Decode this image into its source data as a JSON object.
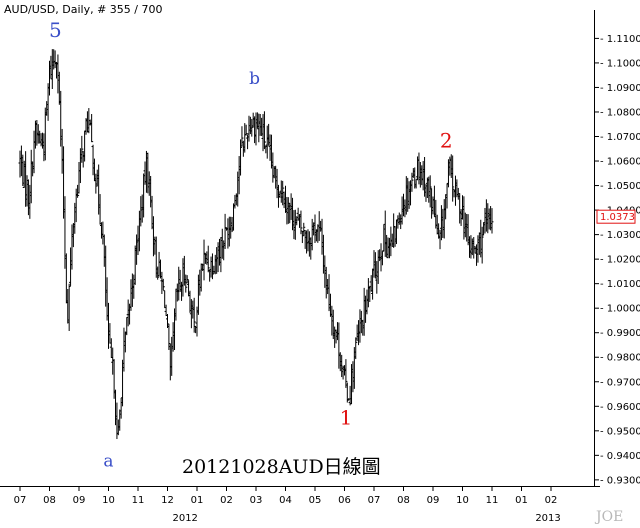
{
  "header": {
    "symbol": "AUD/USD",
    "info": ", Daily, # 355 / 700"
  },
  "annotation": "20121028AUD日線圖",
  "watermark": "JOE",
  "chart_data": {
    "type": "bar",
    "style": "ohlc",
    "ylim": [
      0.9275,
      1.1175
    ],
    "y_ticks": [
      1.11,
      1.1,
      1.09,
      1.08,
      1.07,
      1.06,
      1.05,
      1.04,
      1.03,
      1.02,
      1.01,
      1.0,
      0.99,
      0.98,
      0.97,
      0.96,
      0.95,
      0.94,
      0.93
    ],
    "x_ticks": [
      "07",
      "08",
      "09",
      "10",
      "11",
      "12",
      "01",
      "02",
      "03",
      "04",
      "05",
      "06",
      "07",
      "08",
      "09",
      "10",
      "11",
      "01",
      "02"
    ],
    "year_labels": [
      "2012",
      "2013"
    ],
    "last_price": "1.0373",
    "last_price_value": 1.0373,
    "grid": false,
    "y_axis_position": "right",
    "wave_labels": [
      {
        "label": "5",
        "month": 1.2,
        "price": 1.1105,
        "color": "#3a4fc8"
      },
      {
        "label": "a",
        "month": 3.0,
        "price": 0.9355,
        "color": "#3a4fc8"
      },
      {
        "label": "b",
        "month": 7.95,
        "price": 1.0915,
        "color": "#3a4fc8"
      },
      {
        "label": "1",
        "month": 11.05,
        "price": 0.9525,
        "color": "#e01010"
      },
      {
        "label": "2",
        "month": 14.45,
        "price": 1.0655,
        "color": "#e01010"
      }
    ],
    "anchors": [
      [
        0.0,
        1.06
      ],
      [
        0.3,
        1.045
      ],
      [
        0.5,
        1.072
      ],
      [
        0.8,
        1.066
      ],
      [
        1.0,
        1.096
      ],
      [
        1.25,
        1.105
      ],
      [
        1.45,
        1.05
      ],
      [
        1.6,
        0.995
      ],
      [
        1.8,
        1.035
      ],
      [
        2.0,
        1.055
      ],
      [
        2.3,
        1.078
      ],
      [
        2.6,
        1.05
      ],
      [
        2.8,
        1.03
      ],
      [
        3.0,
        0.985
      ],
      [
        3.2,
        0.97
      ],
      [
        3.3,
        0.942
      ],
      [
        3.5,
        0.98
      ],
      [
        3.7,
        1.0
      ],
      [
        4.0,
        1.03
      ],
      [
        4.3,
        1.06
      ],
      [
        4.6,
        1.02
      ],
      [
        4.9,
        1.005
      ],
      [
        5.1,
        0.972
      ],
      [
        5.3,
        1.005
      ],
      [
        5.6,
        1.015
      ],
      [
        5.9,
        0.992
      ],
      [
        6.2,
        1.02
      ],
      [
        6.5,
        1.018
      ],
      [
        6.9,
        1.028
      ],
      [
        7.2,
        1.038
      ],
      [
        7.5,
        1.065
      ],
      [
        7.8,
        1.076
      ],
      [
        8.1,
        1.075
      ],
      [
        8.4,
        1.065
      ],
      [
        8.6,
        1.053
      ],
      [
        8.9,
        1.048
      ],
      [
        9.2,
        1.038
      ],
      [
        9.5,
        1.033
      ],
      [
        9.8,
        1.028
      ],
      [
        10.0,
        1.034
      ],
      [
        10.2,
        1.029
      ],
      [
        10.4,
        1.008
      ],
      [
        10.6,
        0.995
      ],
      [
        10.8,
        0.985
      ],
      [
        11.0,
        0.97
      ],
      [
        11.15,
        0.964
      ],
      [
        11.4,
        0.985
      ],
      [
        11.7,
        1.0
      ],
      [
        12.0,
        1.014
      ],
      [
        12.3,
        1.028
      ],
      [
        12.6,
        1.025
      ],
      [
        12.9,
        1.04
      ],
      [
        13.2,
        1.05
      ],
      [
        13.5,
        1.058
      ],
      [
        13.8,
        1.05
      ],
      [
        14.0,
        1.042
      ],
      [
        14.2,
        1.025
      ],
      [
        14.4,
        1.042
      ],
      [
        14.55,
        1.057
      ],
      [
        14.8,
        1.045
      ],
      [
        15.0,
        1.04
      ],
      [
        15.2,
        1.025
      ],
      [
        15.45,
        1.023
      ],
      [
        15.7,
        1.031
      ],
      [
        15.9,
        1.035
      ],
      [
        16.0,
        1.0373
      ]
    ]
  }
}
